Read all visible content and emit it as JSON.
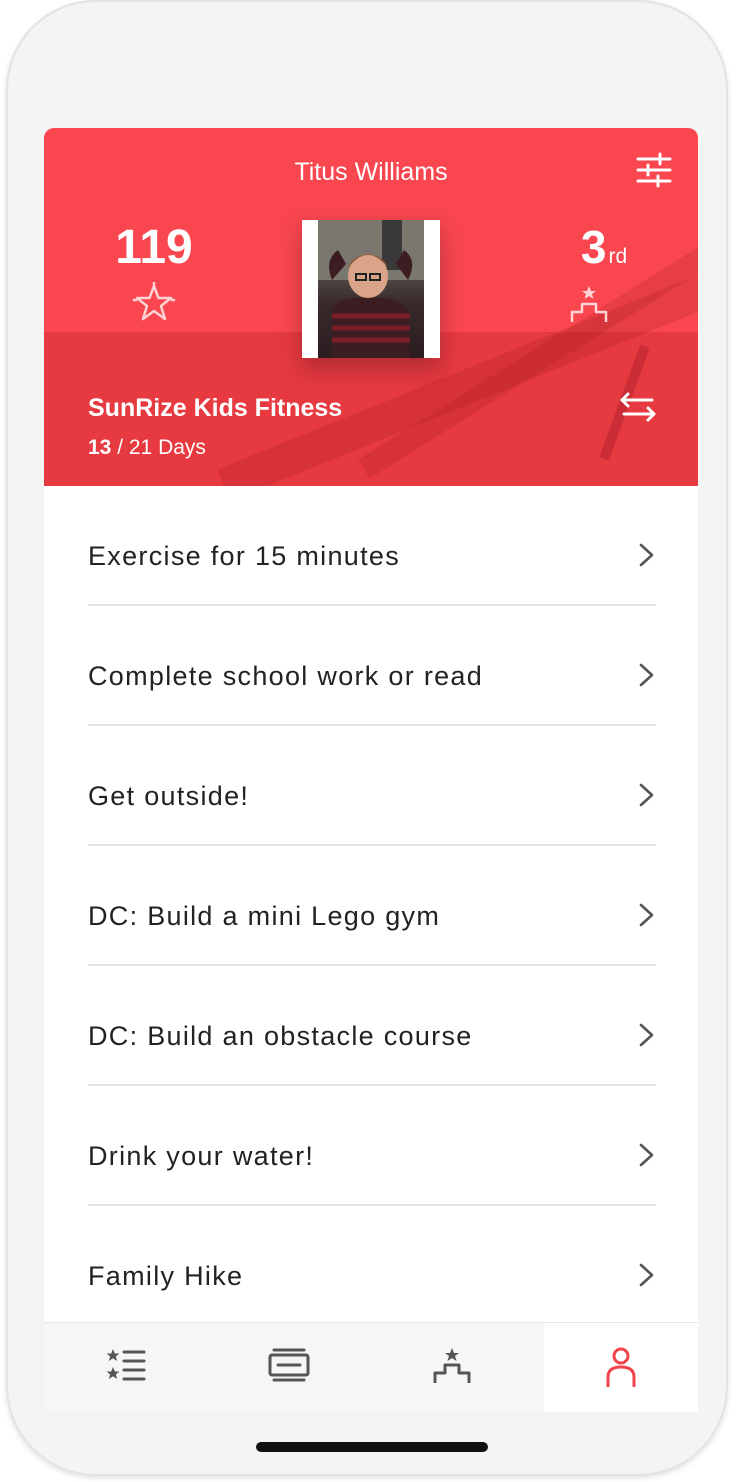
{
  "header": {
    "user_name": "Titus Williams",
    "points": "119",
    "rank_number": "3",
    "rank_suffix": "rd",
    "program": {
      "title": "SunRize Kids Fitness",
      "days_current": "13",
      "days_total": "/ 21 Days"
    },
    "icons": {
      "filter": "sliders-icon",
      "points": "star-burst-icon",
      "rank": "podium-icon",
      "switch": "swap-arrows-icon"
    }
  },
  "tasks": [
    {
      "label": "Exercise for 15 minutes"
    },
    {
      "label": "Complete school work or read"
    },
    {
      "label": "Get outside!"
    },
    {
      "label": "DC: Build a mini Lego gym"
    },
    {
      "label": "DC: Build an obstacle course"
    },
    {
      "label": "Drink your water!"
    },
    {
      "label": "Family Hike"
    }
  ],
  "tabbar": {
    "tabs": [
      {
        "icon": "star-list-icon",
        "active": false
      },
      {
        "icon": "news-feed-icon",
        "active": false
      },
      {
        "icon": "leaderboard-podium-icon",
        "active": false
      },
      {
        "icon": "profile-person-icon",
        "active": true
      }
    ]
  },
  "colors": {
    "brand_red": "#f9464f",
    "brand_red_dark": "#e63940",
    "active_tab_icon": "#f0444c",
    "inactive_tab_icon": "#555555"
  }
}
